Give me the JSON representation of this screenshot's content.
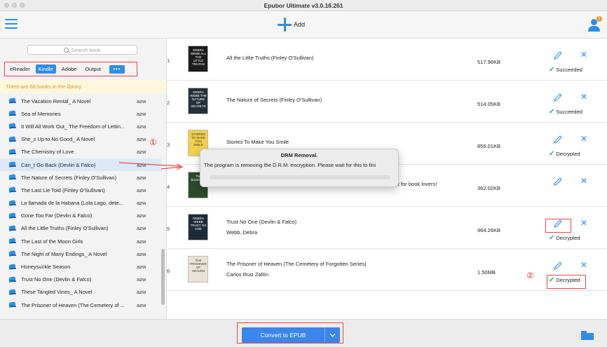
{
  "window": {
    "title": "Epubor Ultimate v3.0.16.261"
  },
  "toolbar": {
    "add_label": "Add",
    "notification_count": "1"
  },
  "sidebar": {
    "search_placeholder": "Search book",
    "tabs": [
      "eReader",
      "Kindle",
      "Adobe",
      "Output",
      "•••"
    ],
    "active_tab": "Kindle",
    "count_text": "There are 68 books in the library.",
    "books": [
      {
        "name": "The Vacation Rental_ A Novel",
        "format": "azw"
      },
      {
        "name": "Sea of Memories",
        "format": "azw"
      },
      {
        "name": "It Will All Work Out_ The Freedom of Lettin...",
        "format": "azw"
      },
      {
        "name": "She_s Up to No Good_ A Novel",
        "format": "azw"
      },
      {
        "name": "The Chemistry of Love",
        "format": "azw"
      },
      {
        "name": "Can_t Go Back (Devlin & Falco)",
        "format": "azw"
      },
      {
        "name": "The Nature of Secrets (Finley O'Sullivan)",
        "format": "azw"
      },
      {
        "name": "The Last Lie Told (Finley O'Sullivan)",
        "format": "azw"
      },
      {
        "name": "La llamada de la Habana (Lola Lago, dete...",
        "format": "azw"
      },
      {
        "name": "Gone Too Far (Devlin & Falco)",
        "format": "azw"
      },
      {
        "name": "All the Little Truths (Finley O'Sullivan)",
        "format": "azw"
      },
      {
        "name": "The Last of the Moon Girls",
        "format": "azw"
      },
      {
        "name": "The Night of Many Endings_ A Novel",
        "format": "azw"
      },
      {
        "name": "Honeysuckle Season",
        "format": "azw"
      },
      {
        "name": "Trust No One (Devlin & Falco)",
        "format": "azw"
      },
      {
        "name": "These Tangled Vines_ A Novel",
        "format": "azw"
      },
      {
        "name": "The Prisoner of Heaven (The Cemetery of ...",
        "format": "azw"
      }
    ],
    "selected_index": 5
  },
  "markers": {
    "m1": "①",
    "m2": "②",
    "m3": "③"
  },
  "queue": [
    {
      "num": "1",
      "title": "All the Little Truths (Finley O'Sullivan)",
      "author": "",
      "size": "517.96KB",
      "status": "Succeeded",
      "cover_text": "DEBRA WEBB ALL THE LITTLE TRUTHS",
      "cover_color": "#1c1c1c"
    },
    {
      "num": "2",
      "title": "The Nature of Secrets (Finley O'Sullivan)",
      "author": "",
      "size": "514.05KB",
      "status": "Succeeded",
      "cover_text": "DEBRA WEBB THE NATURE OF SECRETS",
      "cover_color": "#24303a"
    },
    {
      "num": "3",
      "title": "Stories To Make You Smile",
      "author": "",
      "size": "856.01KB",
      "status": "Decrypted",
      "cover_text": "STORIES TO MAKE YOU SMILE",
      "cover_color": "#f1d04a"
    },
    {
      "num": "4",
      "title": "nd the perfect gift for book lovers!",
      "author": "",
      "size": "362.02KB",
      "status": "",
      "cover_text": "The Bookseller",
      "cover_color": "#2e4a2c"
    },
    {
      "num": "5",
      "title": "Trust No One (Devlin & Falco)",
      "author": "Webb, Debra",
      "size": "964.26KB",
      "status": "Decrypted",
      "cover_text": "DEBRA WEBB TRUST NO ONE",
      "cover_color": "#1d2a3a"
    },
    {
      "num": "6",
      "title": "The Prisoner of Heaven (The Cemetery of Forgotten Series)",
      "author": "Carlos Ruiz Zafón",
      "size": "1.50MB",
      "status": "Decrypted",
      "cover_text": "THE PRISONER OF HEAVEN",
      "cover_color": "#e9e3d6"
    }
  ],
  "dialog": {
    "title": "DRM Removal.",
    "message": "The program is removing the D.R.M. encryption. Please wait for this to fini"
  },
  "bottom": {
    "convert_label": "Convert to EPUB"
  },
  "colors": {
    "accent": "#2d8ee8",
    "annotation_red": "#e8474b",
    "success_green": "#2bb04a"
  },
  "icons": [
    "hamburger-icon",
    "plus-icon",
    "user-icon",
    "search-icon",
    "book-icon",
    "edit-icon",
    "close-icon",
    "check-icon",
    "chevron-down-icon",
    "folder-icon"
  ]
}
